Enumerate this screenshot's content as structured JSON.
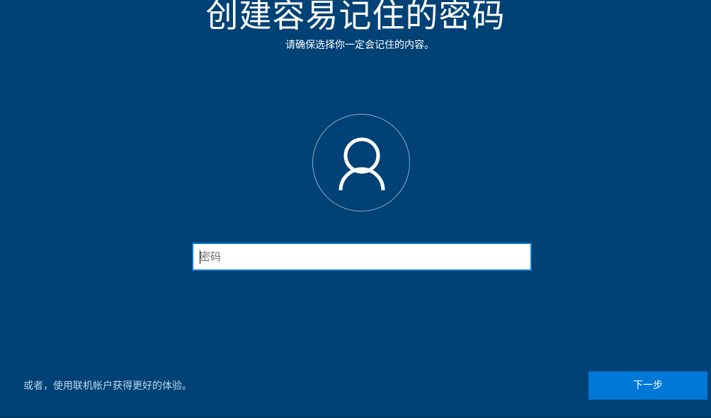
{
  "page": {
    "title": "创建容易记住的密码",
    "subtitle": "请确保选择你一定会记住的内容。"
  },
  "avatar": {
    "icon": "user-icon"
  },
  "password_field": {
    "placeholder": "密码",
    "value": ""
  },
  "footer": {
    "alt_link": "或者，使用联机帐户获得更好的体验。",
    "next_label": "下一步"
  },
  "colors": {
    "background": "#004275",
    "accent": "#0078d7",
    "link": "#bcd7ef"
  }
}
